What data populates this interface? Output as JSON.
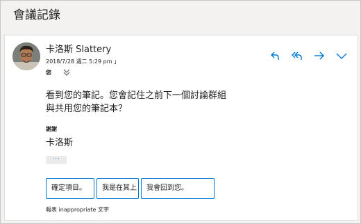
{
  "page": {
    "title": "會議記錄"
  },
  "message": {
    "sender_name": "卡洛斯 Slattery",
    "date": "2018/7/28 週二 5:29 pm 」",
    "to_label": "您",
    "body_line_1": "看到您的筆記。您會記住之前下一個討論群組",
    "body_line_2": "與共用您的筆記本？",
    "signoff_label": "謝謝",
    "signoff_name": "卡洛斯",
    "more_label": "···"
  },
  "actions": [
    {
      "name": "reply",
      "icon": "reply-icon"
    },
    {
      "name": "reply-all",
      "icon": "reply-all-icon"
    },
    {
      "name": "forward",
      "icon": "forward-arrow-icon"
    },
    {
      "name": "more",
      "icon": "chevron-down-icon"
    }
  ],
  "suggested_replies": [
    "確定項目。",
    "我是在其上",
    "我會回到您。"
  ],
  "report": {
    "text": "報表 inappropriate 文字"
  },
  "colors": {
    "accent": "#0078d4",
    "background": "#f3f2f1",
    "card": "#ffffff"
  }
}
